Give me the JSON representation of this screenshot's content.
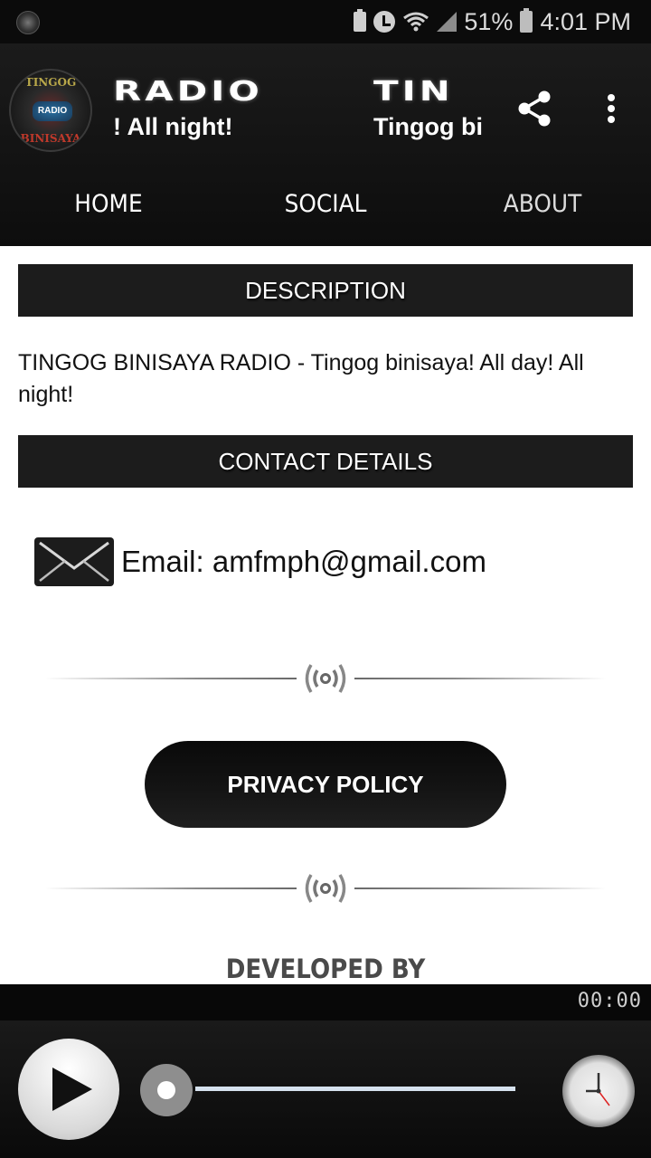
{
  "status_bar": {
    "battery_percent": "51%",
    "time": "4:01 PM",
    "icons": [
      "app-notification-icon",
      "battery-saver-icon",
      "alarm-icon",
      "wifi-icon",
      "signal-icon",
      "battery-charging-icon"
    ]
  },
  "header": {
    "logo": {
      "top_text": "TINGOG",
      "center_text": "RADIO",
      "bottom_text": "BINISAYA"
    },
    "marquee": [
      {
        "title": "RADIO",
        "subtitle": "! All night!"
      },
      {
        "title": "TIN",
        "subtitle": "Tingog bi"
      }
    ],
    "share_icon": "share-icon",
    "more_icon": "more-vert-icon"
  },
  "tabs": [
    {
      "label": "HOME"
    },
    {
      "label": "SOCIAL"
    },
    {
      "label": "ABOUT",
      "active": true
    }
  ],
  "content": {
    "description_header": "DESCRIPTION",
    "description_text": "TINGOG BINISAYA RADIO - Tingog binisaya! All day! All night!",
    "contact_header": "CONTACT DETAILS",
    "email_label": "Email: amfmph@gmail.com",
    "privacy_button": "PRIVACY POLICY",
    "developed_by": "DEVELOPED BY"
  },
  "player": {
    "elapsed": "00:00",
    "progress": 0,
    "play_icon": "play-icon",
    "timer_icon": "clock-icon"
  },
  "colors": {
    "header_bg": "#151515",
    "section_header_bg": "#1c1c1c",
    "seek_track": "#d6e2ee"
  }
}
